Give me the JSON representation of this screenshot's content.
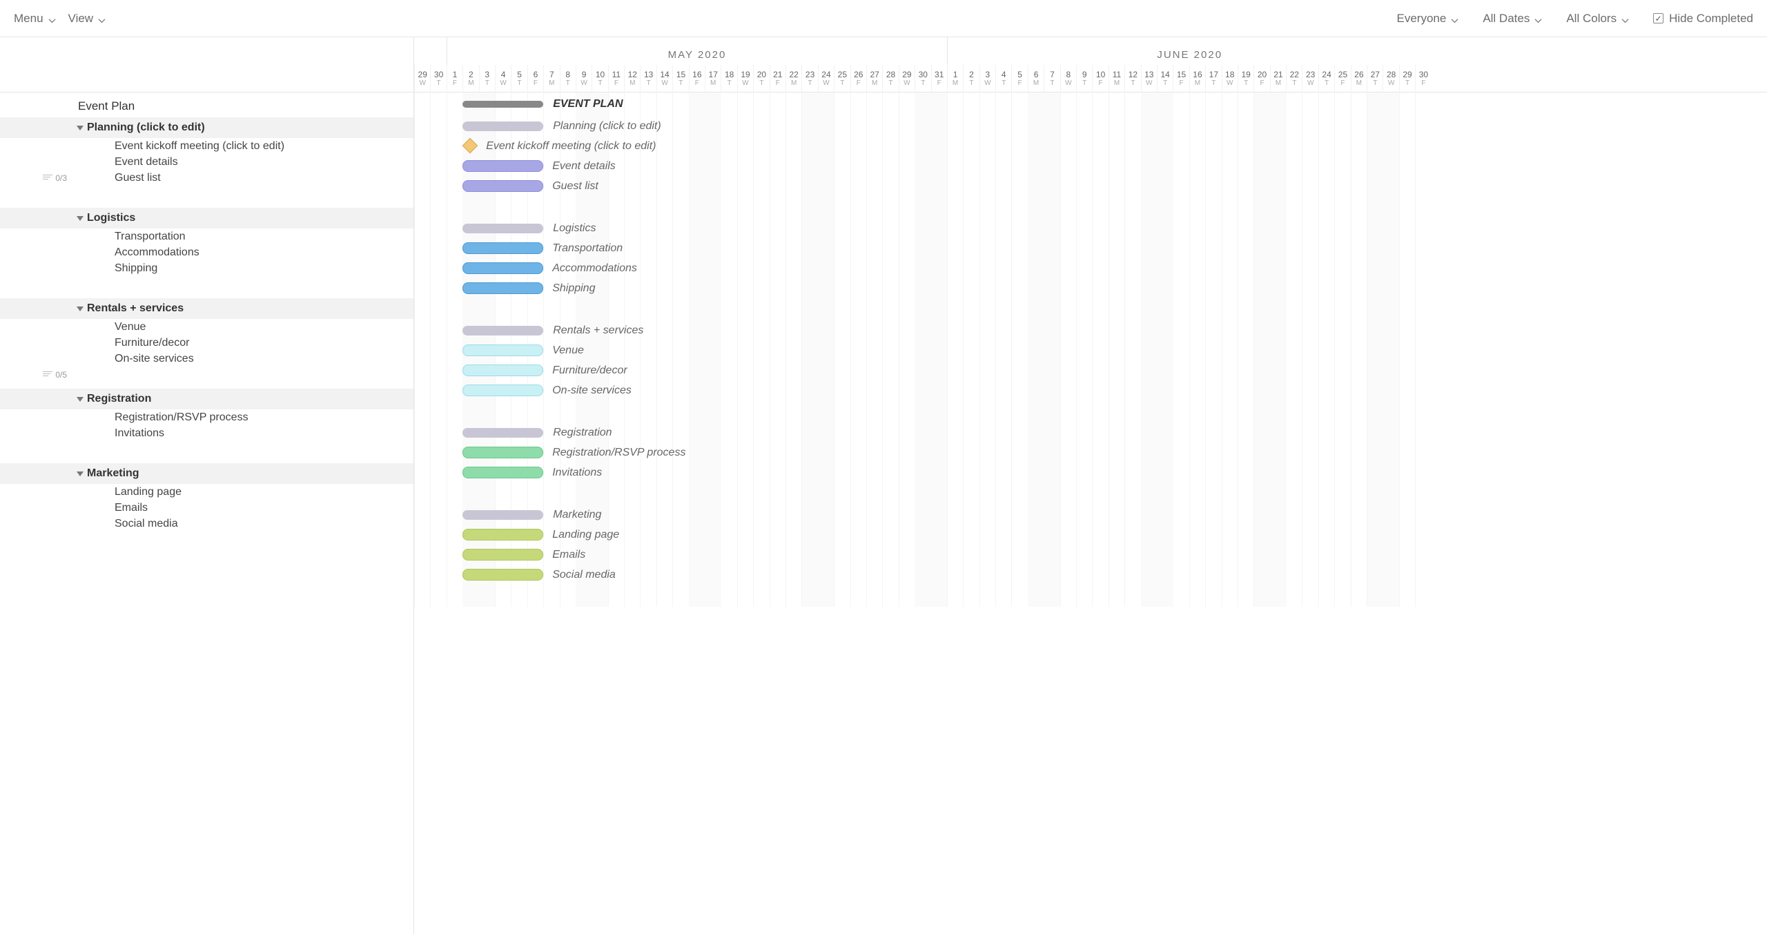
{
  "toolbar": {
    "menu": "Menu",
    "view": "View",
    "filters": {
      "everyone": "Everyone",
      "all_dates": "All Dates",
      "all_colors": "All Colors"
    },
    "hide_completed": "Hide Completed",
    "hide_completed_checked": true
  },
  "timeline": {
    "months": [
      {
        "label": "MAY 2020",
        "days": 31,
        "col_start": 2
      },
      {
        "label": "JUNE 2020",
        "days": 30,
        "col_start": 33
      }
    ],
    "lead_days": [
      {
        "num": "29",
        "dow": "W"
      },
      {
        "num": "30",
        "dow": "T"
      }
    ],
    "day_letters_may": [
      "F",
      "M",
      "T",
      "W",
      "T",
      "F",
      "M",
      "T",
      "W",
      "T",
      "F",
      "M",
      "T",
      "W",
      "T",
      "F",
      "M",
      "T",
      "W",
      "T",
      "F",
      "M",
      "T",
      "W",
      "T",
      "F",
      "M",
      "T",
      "W",
      "T",
      "F"
    ],
    "day_letters_june": [
      "M",
      "T",
      "W",
      "T",
      "F",
      "M",
      "T",
      "W",
      "T",
      "F",
      "M",
      "T",
      "W",
      "T",
      "F",
      "M",
      "T",
      "W",
      "T",
      "F",
      "M",
      "T",
      "W",
      "T",
      "F",
      "M",
      "T",
      "W",
      "T",
      "F"
    ]
  },
  "project": {
    "title": "Event Plan",
    "title_bar_label": "EVENT PLAN",
    "groups": [
      {
        "name": "Planning (click to edit)",
        "summary_start": 3,
        "summary_span": 5,
        "color": "#a7a7e6",
        "border": "#8e8ed9",
        "tasks": [
          {
            "name": "Event kickoff meeting (click to edit)",
            "type": "milestone",
            "start": 3
          },
          {
            "name": "Event details",
            "start": 3,
            "span": 5,
            "progress": "0/3"
          },
          {
            "name": "Guest list",
            "start": 3,
            "span": 5
          }
        ]
      },
      {
        "name": "Logistics",
        "summary_start": 3,
        "summary_span": 5,
        "color": "#6fb4e6",
        "border": "#4c99d4",
        "tasks": [
          {
            "name": "Transportation",
            "start": 3,
            "span": 5
          },
          {
            "name": "Accommodations",
            "start": 3,
            "span": 5
          },
          {
            "name": "Shipping",
            "start": 3,
            "span": 5
          }
        ]
      },
      {
        "name": "Rentals + services",
        "summary_start": 3,
        "summary_span": 5,
        "color": "#c9f0f5",
        "border": "#9cdce6",
        "tasks": [
          {
            "name": "Venue",
            "start": 3,
            "span": 5
          },
          {
            "name": "Furniture/decor",
            "start": 3,
            "span": 5
          },
          {
            "name": "On-site services",
            "start": 3,
            "span": 5,
            "progress": "0/5"
          }
        ]
      },
      {
        "name": "Registration",
        "summary_start": 3,
        "summary_span": 5,
        "color": "#8edcaa",
        "border": "#6cc68d",
        "tasks": [
          {
            "name": "Registration/RSVP process",
            "start": 3,
            "span": 5
          },
          {
            "name": "Invitations",
            "start": 3,
            "span": 5
          }
        ]
      },
      {
        "name": "Marketing",
        "summary_start": 3,
        "summary_span": 5,
        "color": "#c5d97a",
        "border": "#aec55b",
        "tasks": [
          {
            "name": "Landing page",
            "start": 3,
            "span": 5
          },
          {
            "name": "Emails",
            "start": 3,
            "span": 5
          },
          {
            "name": "Social media",
            "start": 3,
            "span": 5
          }
        ]
      }
    ]
  }
}
